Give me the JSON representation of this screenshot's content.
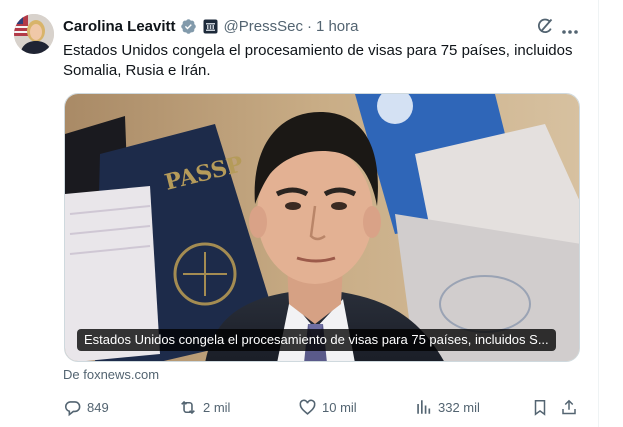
{
  "author": {
    "name": "Carolina Leavitt",
    "handle": "@PressSec",
    "separator": "·",
    "time": "1 hora"
  },
  "icons": {
    "verified": "verified-badge-icon",
    "affiliation": "government-affiliation-icon",
    "grok": "grok-icon",
    "more": "more-options-icon",
    "reply": "reply-icon",
    "retweet": "retweet-icon",
    "like": "like-icon",
    "views": "views-icon",
    "bookmark": "bookmark-icon",
    "share": "share-icon"
  },
  "tweet": {
    "text": "Estados Unidos congela el procesamiento de visas para 75 países, incluidos Somalia, Rusia e Irán."
  },
  "card": {
    "title": "Estados Unidos congela el procesamiento de visas para 75 países, incluidos S...",
    "source": "De foxnews.com"
  },
  "actions": {
    "replies": "849",
    "reposts": "2 mil",
    "likes": "10 mil",
    "views": "332 mil"
  },
  "colors": {
    "text": "#0f1419",
    "secondary": "#536471",
    "verified": "#829aab",
    "border": "#cfd9de"
  }
}
